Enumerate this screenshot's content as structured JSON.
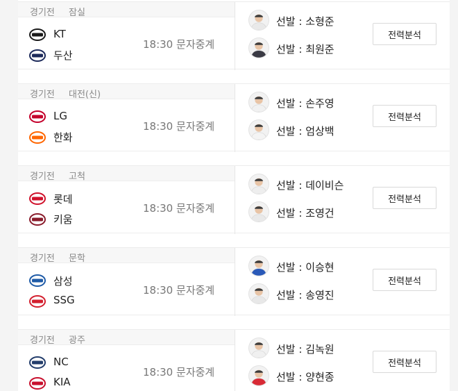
{
  "games": [
    {
      "category": "경기전",
      "stadium": "잠실",
      "home": {
        "name": "KT",
        "logo": "kt-wiz-logo",
        "color": "#1a1a1a"
      },
      "away": {
        "name": "두산",
        "logo": "doosan-bears-logo",
        "color": "#1c2a5a"
      },
      "time": "18:30",
      "broadcast": "문자중계",
      "pitchers": [
        {
          "label": "선발",
          "name": "소형준",
          "avatar": "player-photo",
          "uniform": "#e9e9e9"
        },
        {
          "label": "선발",
          "name": "최원준",
          "avatar": "player-photo",
          "uniform": "#3a3a44"
        }
      ],
      "analysis_label": "전력분석"
    },
    {
      "category": "경기전",
      "stadium": "대전(신)",
      "home": {
        "name": "LG",
        "logo": "lg-twins-logo",
        "color": "#c4002b"
      },
      "away": {
        "name": "한화",
        "logo": "hanwha-eagles-logo",
        "color": "#ff6600"
      },
      "time": "18:30",
      "broadcast": "문자중계",
      "pitchers": [
        {
          "label": "선발",
          "name": "손주영",
          "avatar": "player-photo",
          "uniform": "#f1f1f1"
        },
        {
          "label": "선발",
          "name": "엄상백",
          "avatar": "player-photo",
          "uniform": "#f4f4f4"
        }
      ],
      "analysis_label": "전력분석"
    },
    {
      "category": "경기전",
      "stadium": "고척",
      "home": {
        "name": "롯데",
        "logo": "lotte-giants-logo",
        "color": "#d0112b"
      },
      "away": {
        "name": "키움",
        "logo": "kiwoom-heroes-logo",
        "color": "#8a1c2c"
      },
      "time": "18:30",
      "broadcast": "문자중계",
      "pitchers": [
        {
          "label": "선발",
          "name": "데이비슨",
          "avatar": "player-photo",
          "uniform": "#eeeeee"
        },
        {
          "label": "선발",
          "name": "조영건",
          "avatar": "player-photo",
          "uniform": "#e9e9e9"
        }
      ],
      "analysis_label": "전력분석"
    },
    {
      "category": "경기전",
      "stadium": "문학",
      "home": {
        "name": "삼성",
        "logo": "samsung-lions-logo",
        "color": "#1f5ba7"
      },
      "away": {
        "name": "SSG",
        "logo": "ssg-landers-logo",
        "color": "#d3202f"
      },
      "time": "18:30",
      "broadcast": "문자중계",
      "pitchers": [
        {
          "label": "선발",
          "name": "이승현",
          "avatar": "player-photo",
          "uniform": "#2a59b8"
        },
        {
          "label": "선발",
          "name": "송영진",
          "avatar": "player-photo",
          "uniform": "#e8e8e8"
        }
      ],
      "analysis_label": "전력분석"
    },
    {
      "category": "경기전",
      "stadium": "광주",
      "home": {
        "name": "NC",
        "logo": "nc-dinos-logo",
        "color": "#233d6b"
      },
      "away": {
        "name": "KIA",
        "logo": "kia-tigers-logo",
        "color": "#c8102e"
      },
      "time": "18:30",
      "broadcast": "문자중계",
      "pitchers": [
        {
          "label": "선발",
          "name": "김녹원",
          "avatar": "player-photo",
          "uniform": "#f0f0f0"
        },
        {
          "label": "선발",
          "name": "양현종",
          "avatar": "player-photo",
          "uniform": "#d82a35"
        }
      ],
      "analysis_label": "전력분석"
    }
  ]
}
